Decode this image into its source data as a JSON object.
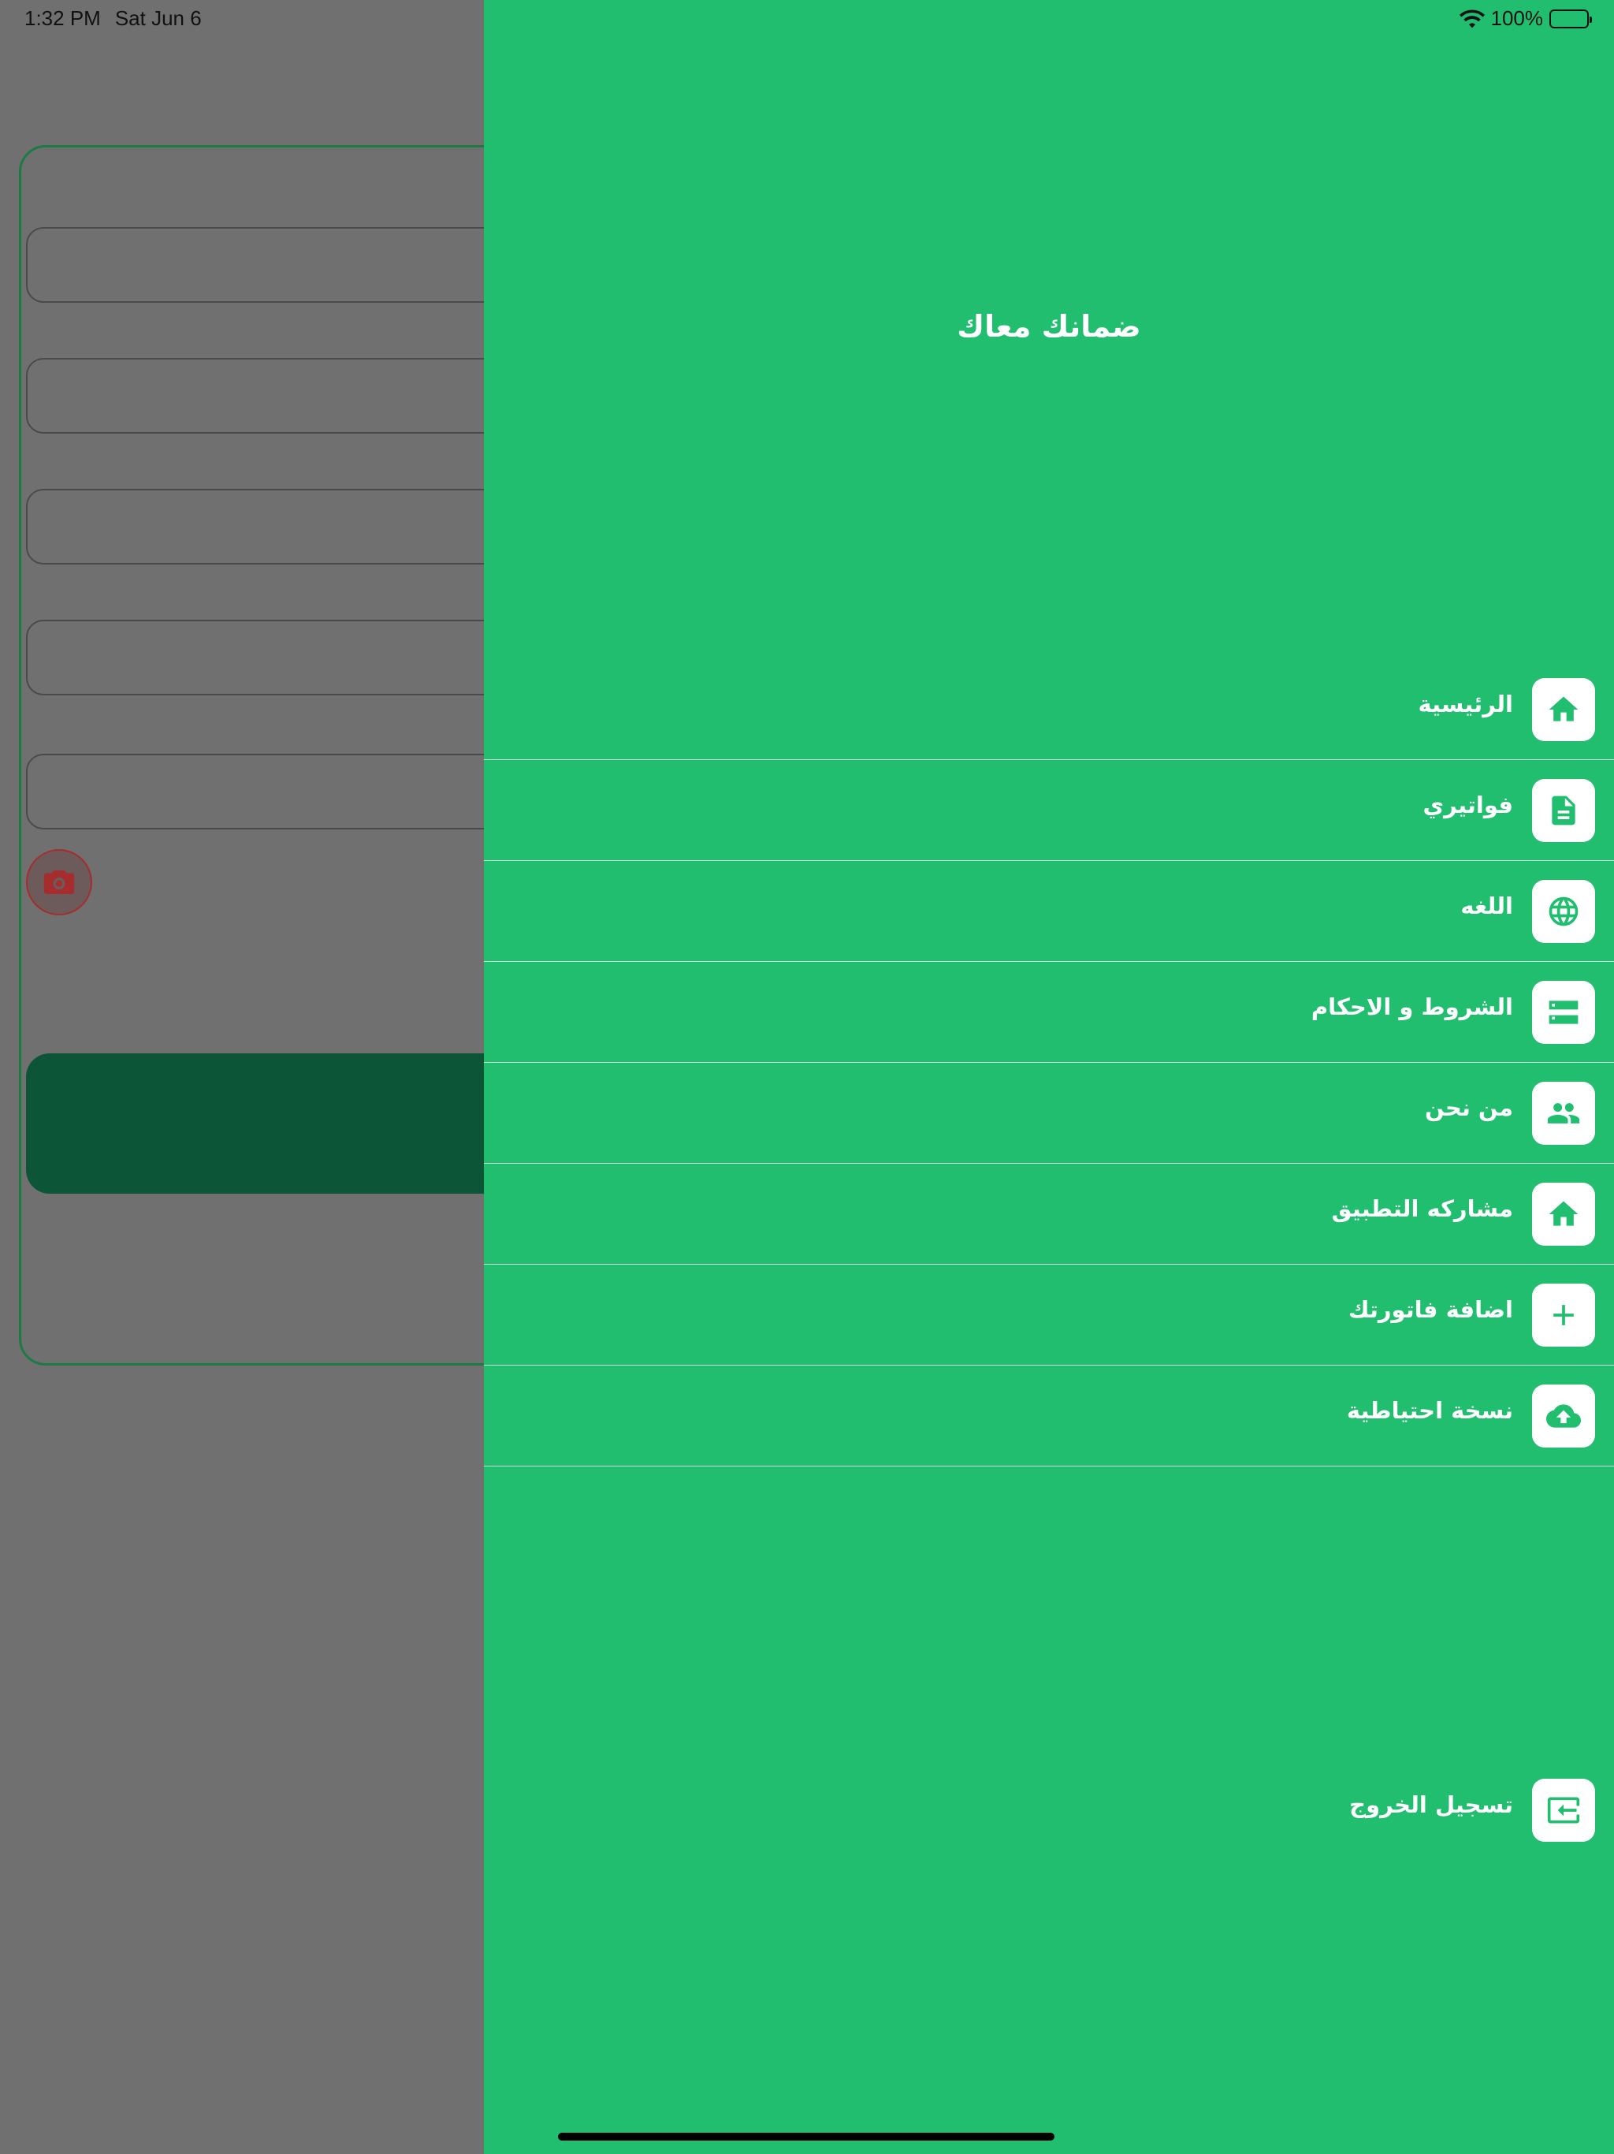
{
  "status_bar": {
    "time": "1:32 PM",
    "date": "Sat Jun 6",
    "battery": "100%"
  },
  "drawer": {
    "title": "ضمانك معاك",
    "items": [
      {
        "label": "الرئيسية",
        "icon": "home-icon"
      },
      {
        "label": "فواتيري",
        "icon": "document-icon"
      },
      {
        "label": "اللغه",
        "icon": "globe-icon"
      },
      {
        "label": "الشروط و الاحكام",
        "icon": "storage-icon"
      },
      {
        "label": "من نحن",
        "icon": "people-icon"
      },
      {
        "label": "مشاركه التطبيق",
        "icon": "home-icon"
      },
      {
        "label": "اضافة فاتورتك",
        "icon": "plus-icon"
      },
      {
        "label": "نسخة احتياطية",
        "icon": "cloud-upload-icon"
      }
    ],
    "logout": {
      "label": "تسجيل الخروج",
      "icon": "logout-icon"
    }
  },
  "colors": {
    "drawer_bg": "#21be70",
    "overlay": "#707070",
    "submit_button": "#0d5537"
  }
}
